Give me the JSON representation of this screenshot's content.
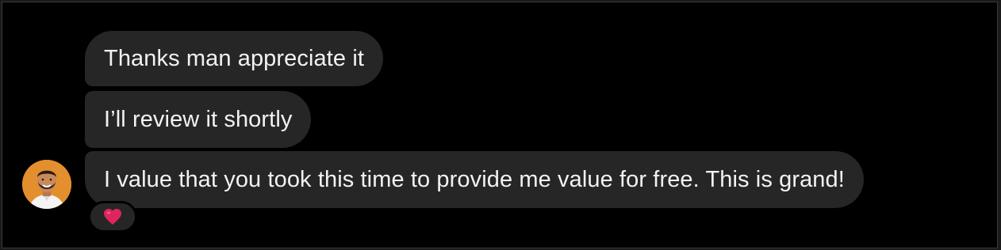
{
  "conversation": {
    "messages": [
      {
        "text": "Thanks man appreciate it"
      },
      {
        "text": "I’ll review it shortly"
      },
      {
        "text": "I value that you took this time to provide me value for free. This is grand!"
      }
    ],
    "reaction": {
      "icon": "red-heart-icon",
      "color": "#e0245e"
    },
    "avatar": {
      "icon": "profile-photo",
      "background": "#e38f2e"
    }
  },
  "colors": {
    "background": "#000000",
    "bubble": "#262626",
    "text": "#f2f2f2"
  }
}
